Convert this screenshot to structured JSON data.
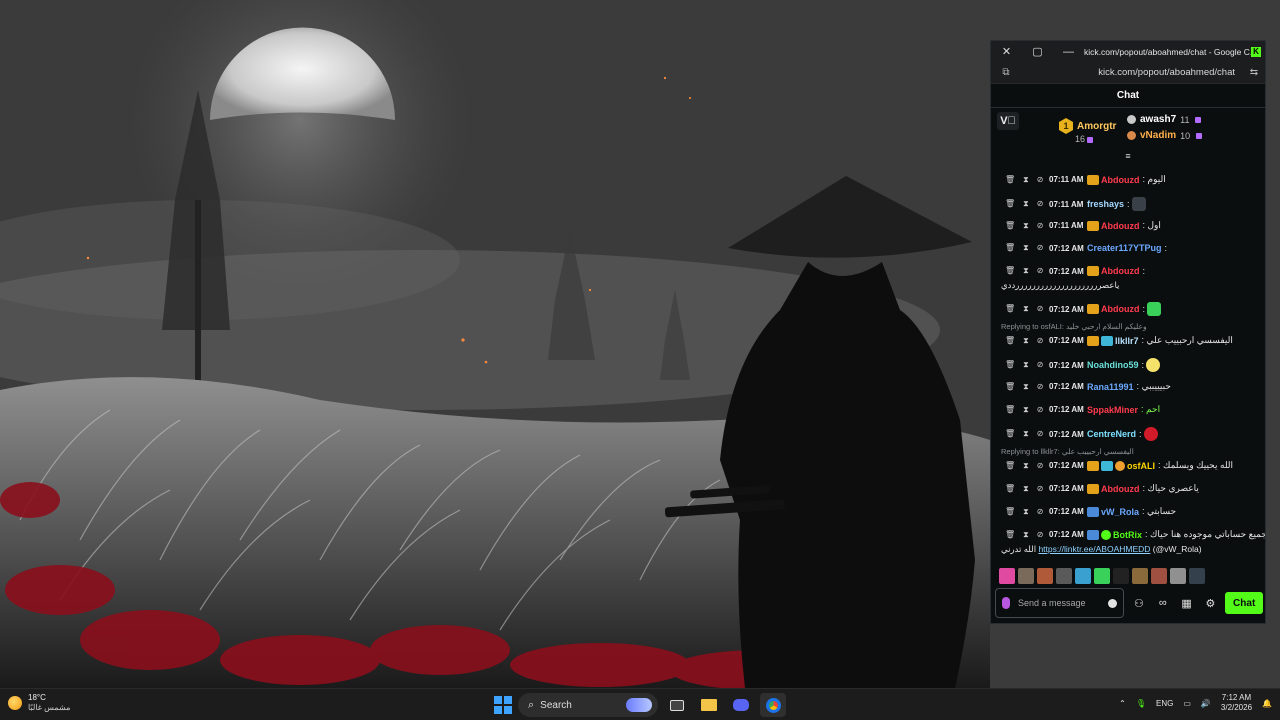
{
  "window": {
    "title": "kick.com/popout/aboahmed/chat - Google C...",
    "url": "kick.com/popout/aboahmed/chat"
  },
  "chat": {
    "header": "Chat",
    "vbutton": "V⃞",
    "leaderboard": {
      "first": {
        "rank": "1",
        "name": "Amorgtr",
        "count": "16"
      },
      "second": {
        "name": "awash7",
        "count": "11"
      },
      "third": {
        "name": "vNadim",
        "count": "10"
      }
    },
    "messages": [
      {
        "time": "07:11 AM",
        "user": "Abdouzd",
        "color": "#ff3b4e",
        "text": ": اليوم"
      },
      {
        "time": "07:11 AM",
        "user": "freshays",
        "color": "#a5d8ff",
        "text": ":"
      },
      {
        "time": "07:11 AM",
        "user": "Abdouzd",
        "color": "#ff3b4e",
        "text": ": اول"
      },
      {
        "time": "07:12 AM",
        "user": "Creater117YTPug",
        "color": "#6aa8ff",
        "text": ":"
      },
      {
        "time": "07:12 AM",
        "user": "Abdouzd",
        "color": "#ff3b4e",
        "text": ":"
      },
      {
        "time": "07:12 AM",
        "user": "Abdouzd",
        "color": "#ff3b4e",
        "text": ":"
      },
      {
        "time": "07:12 AM",
        "user": "llkllr7",
        "color": "#b8e4ff",
        "text": ": اليفسسي ارحبييب علي"
      },
      {
        "time": "07:12 AM",
        "user": "Noahdino59",
        "color": "#6ae0d8",
        "text": ":"
      },
      {
        "time": "07:12 AM",
        "user": "Rana11991",
        "color": "#6aa8ff",
        "text": ": حبيييببي"
      },
      {
        "time": "07:12 AM",
        "user": "SppakMiner",
        "color": "#ff3b4e",
        "text": ": احم"
      },
      {
        "time": "07:12 AM",
        "user": "CentreNerd",
        "color": "#7ee0ff",
        "text": ":"
      },
      {
        "time": "07:12 AM",
        "user": "osfALI",
        "color": "#ffd700",
        "text": ": الله يحييك ويسلمك"
      },
      {
        "time": "07:12 AM",
        "user": "Abdouzd",
        "color": "#ff3b4e",
        "text": ": ياعصري حياك"
      },
      {
        "time": "07:12 AM",
        "user": "vW_Rola",
        "color": "#6aa8ff",
        "text": ": حسابتي"
      },
      {
        "time": "07:12 AM",
        "user": "BotRix",
        "color": "#53fc18",
        "text": ": جميع حساباتي موجوده هنا حياك"
      }
    ],
    "continuation_1": "ياعصرررررررررررررررررررررددي",
    "reply_1": "Replying to osfALI: وعليكم السلام ارحبي خليد",
    "reply_2": "Replying to llkllr7: اليفسسي ارحبييب علي",
    "link_text": "https://linktr.ee/ABOAHMEDD",
    "link_tail": "(@vW_Rola)",
    "link_prefix": "الله تدرني",
    "input_placeholder": "Send a message",
    "send_label": "Chat"
  },
  "taskbar": {
    "temp": "18°C",
    "weather_desc": "مشمس غالبًا",
    "search": "Search",
    "lang": "ENG",
    "time": "7:12 AM",
    "date": "3/2/2026"
  }
}
